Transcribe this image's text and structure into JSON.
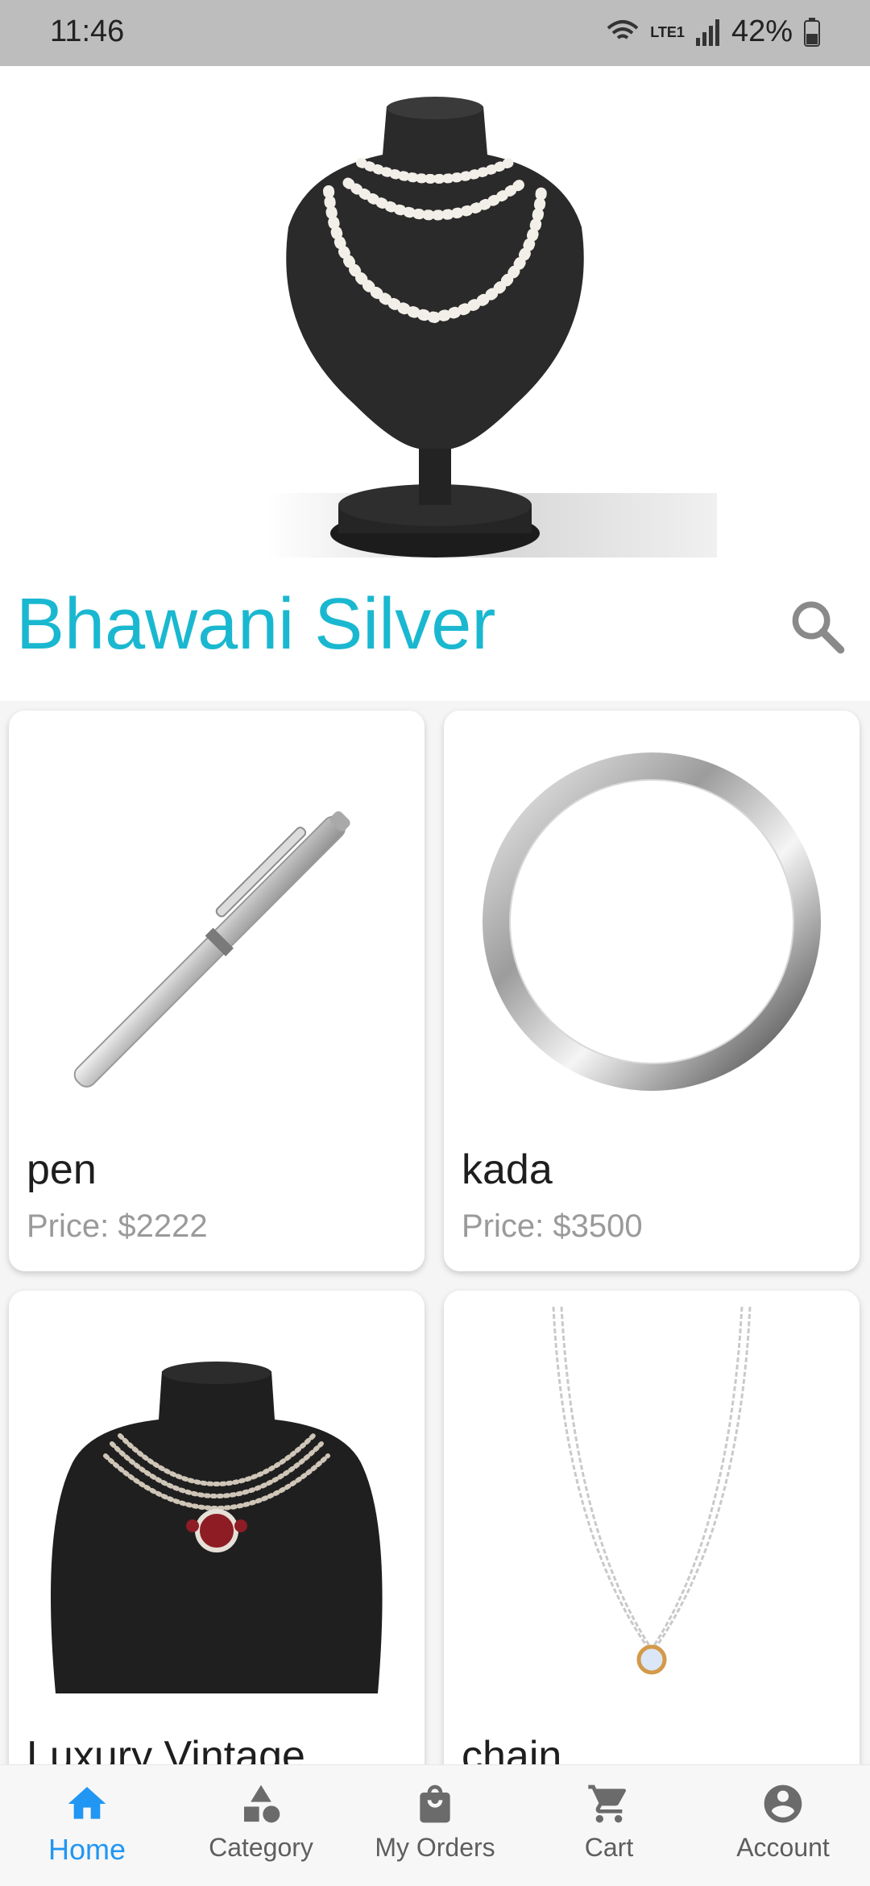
{
  "status_bar": {
    "time": "11:46",
    "battery": "42%",
    "network": "LTE1"
  },
  "app": {
    "title": "Bhawani Silver"
  },
  "products": [
    {
      "name": "pen",
      "price": "Price: $2222",
      "image": "pen-image"
    },
    {
      "name": "kada",
      "price": "Price: $3500",
      "image": "bangle-image"
    },
    {
      "name": "Luxury Vintage ...",
      "price": "",
      "image": "necklace-bust-image"
    },
    {
      "name": "chain",
      "price": "",
      "image": "chain-image"
    }
  ],
  "bottom_nav": [
    {
      "label": "Home",
      "icon": "home-icon",
      "active": true
    },
    {
      "label": "Category",
      "icon": "category-icon"
    },
    {
      "label": "My Orders",
      "icon": "shopping-bag-icon"
    },
    {
      "label": "Cart",
      "icon": "cart-icon"
    },
    {
      "label": "Account",
      "icon": "account-icon"
    }
  ],
  "colors": {
    "accent": "#1ab8d0",
    "nav_active": "#2196f3",
    "status_bar": "#bdbdbd"
  }
}
